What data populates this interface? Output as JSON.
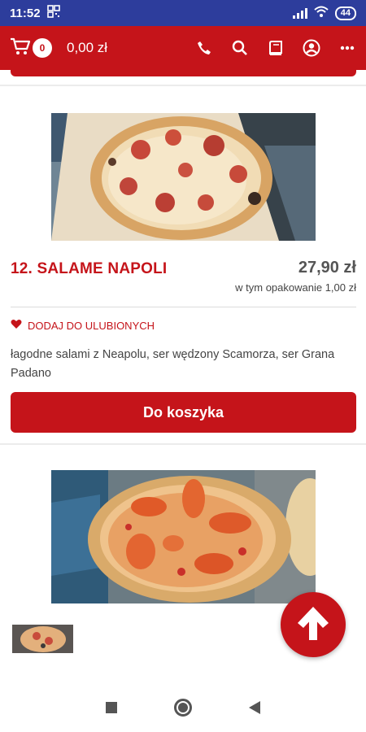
{
  "status": {
    "time": "11:52",
    "battery": "44"
  },
  "header": {
    "cart_count": "0",
    "cart_total": "0,00 zł"
  },
  "product": {
    "title": "12. SALAME NAPOLI",
    "price": "27,90 zł",
    "packaging": "w tym opakowanie 1,00 zł",
    "favorite_label": "DODAJ DO ULUBIONYCH",
    "description": "łagodne salami z Neapolu, ser wędzony Scamorza, ser Grana Padano",
    "add_to_cart_label": "Do koszyka"
  },
  "colors": {
    "brand": "#c5141a",
    "statusbar": "#2d3d9c"
  }
}
